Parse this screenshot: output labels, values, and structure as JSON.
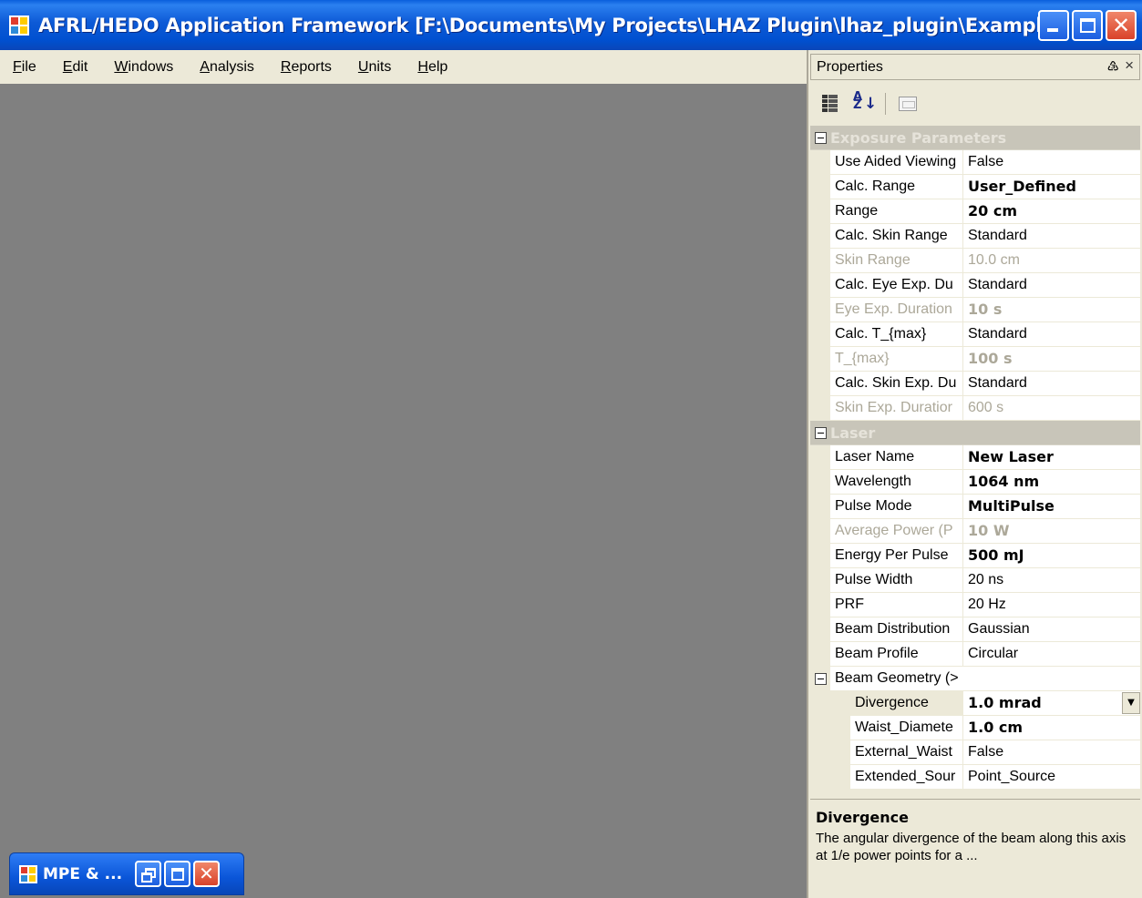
{
  "window": {
    "title": "AFRL/HEDO Application Framework [F:\\Documents\\My Projects\\LHAZ Plugin\\lhaz_plugin\\Examples\\Example ...",
    "icon": "app-windows-icon"
  },
  "menu": {
    "file": {
      "u": "F",
      "rest": "ile"
    },
    "edit": {
      "u": "E",
      "rest": "dit"
    },
    "windows": {
      "u": "W",
      "rest": "indows"
    },
    "analysis": {
      "u": "A",
      "rest": "nalysis"
    },
    "reports": {
      "u": "R",
      "rest": "eports"
    },
    "units": {
      "u": "U",
      "rest": "nits"
    },
    "help": {
      "u": "H",
      "rest": "elp"
    }
  },
  "minimized_window": {
    "title": "MPE & ..."
  },
  "properties": {
    "header": "Properties",
    "pin_glyph": "♵",
    "close_glyph": "×",
    "categories": {
      "exposure": "Exposure Parameters",
      "laser": "Laser"
    },
    "exposure_rows": [
      {
        "name": "Use Aided Viewing",
        "value": "False",
        "bold": false,
        "disabled": false
      },
      {
        "name": "Calc. Range",
        "value": "User_Defined",
        "bold": true,
        "disabled": false
      },
      {
        "name": "Range",
        "value": "20 cm",
        "bold": true,
        "disabled": false
      },
      {
        "name": "Calc. Skin Range",
        "value": "Standard",
        "bold": false,
        "disabled": false
      },
      {
        "name": "Skin Range",
        "value": "10.0 cm",
        "bold": false,
        "disabled": true
      },
      {
        "name": "Calc. Eye Exp. Du",
        "value": "Standard",
        "bold": false,
        "disabled": false
      },
      {
        "name": "Eye Exp. Duration",
        "value": "10 s",
        "bold": true,
        "disabled": true
      },
      {
        "name": "Calc. T_{max}",
        "value": "Standard",
        "bold": false,
        "disabled": false
      },
      {
        "name": "T_{max}",
        "value": "100 s",
        "bold": true,
        "disabled": true
      },
      {
        "name": "Calc. Skin Exp. Du",
        "value": "Standard",
        "bold": false,
        "disabled": false
      },
      {
        "name": "Skin Exp. Duratior",
        "value": "600 s",
        "bold": false,
        "disabled": true
      }
    ],
    "laser_rows": [
      {
        "name": "Laser Name",
        "value": "New Laser",
        "bold": true,
        "disabled": false
      },
      {
        "name": "Wavelength",
        "value": "1064 nm",
        "bold": true,
        "disabled": false
      },
      {
        "name": "Pulse Mode",
        "value": "MultiPulse",
        "bold": true,
        "disabled": false
      },
      {
        "name": "Average Power (P",
        "value": "10 W",
        "bold": true,
        "disabled": true
      },
      {
        "name": "Energy Per Pulse",
        "value": "500 mJ",
        "bold": true,
        "disabled": false
      },
      {
        "name": "Pulse Width",
        "value": "20 ns",
        "bold": false,
        "disabled": false
      },
      {
        "name": "PRF",
        "value": "20 Hz",
        "bold": false,
        "disabled": false
      },
      {
        "name": "Beam Distribution",
        "value": "Gaussian",
        "bold": false,
        "disabled": false
      },
      {
        "name": "Beam Profile",
        "value": "Circular",
        "bold": false,
        "disabled": false
      }
    ],
    "beam_geometry": {
      "label": "Beam Geometry (>",
      "rows": [
        {
          "name": "Divergence",
          "value": "1.0 mrad",
          "bold": true
        },
        {
          "name": "Waist_Diamete",
          "value": "1.0 cm",
          "bold": true
        },
        {
          "name": "External_Waist",
          "value": "False",
          "bold": false
        },
        {
          "name": "Extended_Sour",
          "value": "Point_Source",
          "bold": false
        }
      ]
    },
    "description": {
      "title": "Divergence",
      "text": "The angular divergence of the beam along this axis at 1/e power points for a ..."
    }
  }
}
